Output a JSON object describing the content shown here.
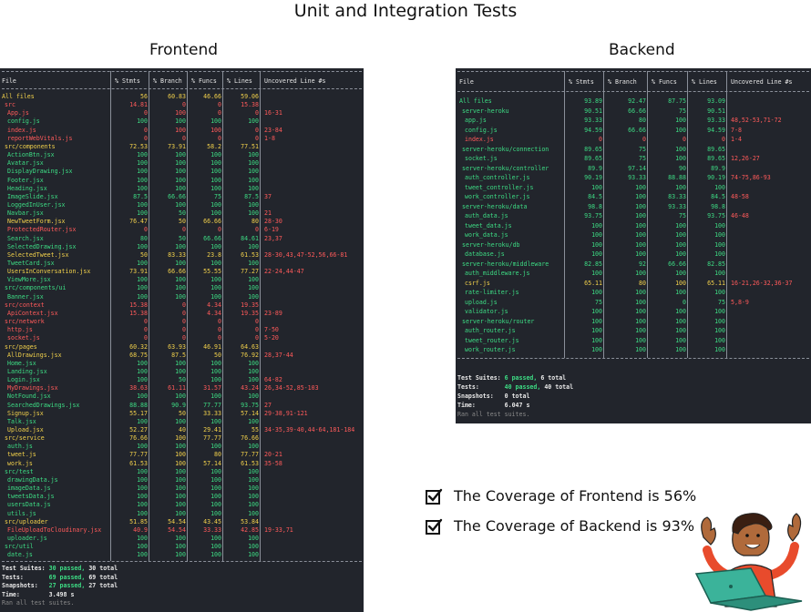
{
  "page": {
    "title": "Unit and Integration Tests",
    "frontend_label": "Frontend",
    "backend_label": "Backend"
  },
  "headers": [
    "File",
    "% Stmts",
    "% Branch",
    "% Funcs",
    "% Lines",
    "Uncovered Line #s"
  ],
  "frontend": {
    "rows": [
      {
        "file": "All files",
        "indent": 0,
        "stmts": "56",
        "branch": "60.83",
        "funcs": "46.66",
        "lines": "59.06",
        "uncovered": "",
        "color": "y"
      },
      {
        "file": "src",
        "indent": 1,
        "stmts": "14.81",
        "branch": "0",
        "funcs": "0",
        "lines": "15.38",
        "uncovered": "",
        "color": "r"
      },
      {
        "file": "App.js",
        "indent": 2,
        "stmts": "0",
        "branch": "100",
        "funcs": "0",
        "lines": "0",
        "uncovered": "16-31",
        "color": "r"
      },
      {
        "file": "config.js",
        "indent": 2,
        "stmts": "100",
        "branch": "100",
        "funcs": "100",
        "lines": "100",
        "uncovered": "",
        "color": "g"
      },
      {
        "file": "index.js",
        "indent": 2,
        "stmts": "0",
        "branch": "100",
        "funcs": "100",
        "lines": "0",
        "uncovered": "23-84",
        "color": "r"
      },
      {
        "file": "reportWebVitals.js",
        "indent": 2,
        "stmts": "0",
        "branch": "0",
        "funcs": "0",
        "lines": "0",
        "uncovered": "1-8",
        "color": "r"
      },
      {
        "file": "src/components",
        "indent": 1,
        "stmts": "72.53",
        "branch": "73.91",
        "funcs": "58.2",
        "lines": "77.51",
        "uncovered": "",
        "color": "y"
      },
      {
        "file": "ActionBtn.jsx",
        "indent": 2,
        "stmts": "100",
        "branch": "100",
        "funcs": "100",
        "lines": "100",
        "uncovered": "",
        "color": "g"
      },
      {
        "file": "Avatar.jsx",
        "indent": 2,
        "stmts": "100",
        "branch": "100",
        "funcs": "100",
        "lines": "100",
        "uncovered": "",
        "color": "g"
      },
      {
        "file": "DisplayDrawing.jsx",
        "indent": 2,
        "stmts": "100",
        "branch": "100",
        "funcs": "100",
        "lines": "100",
        "uncovered": "",
        "color": "g"
      },
      {
        "file": "Footer.jsx",
        "indent": 2,
        "stmts": "100",
        "branch": "100",
        "funcs": "100",
        "lines": "100",
        "uncovered": "",
        "color": "g"
      },
      {
        "file": "Heading.jsx",
        "indent": 2,
        "stmts": "100",
        "branch": "100",
        "funcs": "100",
        "lines": "100",
        "uncovered": "",
        "color": "g"
      },
      {
        "file": "ImageSlide.jsx",
        "indent": 2,
        "stmts": "87.5",
        "branch": "66.66",
        "funcs": "75",
        "lines": "87.5",
        "uncovered": "37",
        "color": "g"
      },
      {
        "file": "LoggedInUser.jsx",
        "indent": 2,
        "stmts": "100",
        "branch": "100",
        "funcs": "100",
        "lines": "100",
        "uncovered": "",
        "color": "g"
      },
      {
        "file": "Navbar.jsx",
        "indent": 2,
        "stmts": "100",
        "branch": "50",
        "funcs": "100",
        "lines": "100",
        "uncovered": "21",
        "color": "g"
      },
      {
        "file": "NewTweetForm.jsx",
        "indent": 2,
        "stmts": "76.47",
        "branch": "50",
        "funcs": "66.66",
        "lines": "80",
        "uncovered": "28-30",
        "color": "y"
      },
      {
        "file": "ProtectedRouter.jsx",
        "indent": 2,
        "stmts": "0",
        "branch": "0",
        "funcs": "0",
        "lines": "0",
        "uncovered": "6-19",
        "color": "r"
      },
      {
        "file": "Search.jsx",
        "indent": 2,
        "stmts": "80",
        "branch": "50",
        "funcs": "66.66",
        "lines": "84.61",
        "uncovered": "23,37",
        "color": "g"
      },
      {
        "file": "SelectedDrawing.jsx",
        "indent": 2,
        "stmts": "100",
        "branch": "100",
        "funcs": "100",
        "lines": "100",
        "uncovered": "",
        "color": "g"
      },
      {
        "file": "SelectedTweet.jsx",
        "indent": 2,
        "stmts": "50",
        "branch": "83.33",
        "funcs": "23.8",
        "lines": "61.53",
        "uncovered": "28-30,43,47-52,56,66-81",
        "color": "y"
      },
      {
        "file": "TweetCard.jsx",
        "indent": 2,
        "stmts": "100",
        "branch": "100",
        "funcs": "100",
        "lines": "100",
        "uncovered": "",
        "color": "g"
      },
      {
        "file": "UsersInConversation.jsx",
        "indent": 2,
        "stmts": "73.91",
        "branch": "66.66",
        "funcs": "55.55",
        "lines": "77.27",
        "uncovered": "22-24,44-47",
        "color": "y"
      },
      {
        "file": "ViewMore.jsx",
        "indent": 2,
        "stmts": "100",
        "branch": "100",
        "funcs": "100",
        "lines": "100",
        "uncovered": "",
        "color": "g"
      },
      {
        "file": "src/components/ui",
        "indent": 1,
        "stmts": "100",
        "branch": "100",
        "funcs": "100",
        "lines": "100",
        "uncovered": "",
        "color": "g"
      },
      {
        "file": "Banner.jsx",
        "indent": 2,
        "stmts": "100",
        "branch": "100",
        "funcs": "100",
        "lines": "100",
        "uncovered": "",
        "color": "g"
      },
      {
        "file": "src/context",
        "indent": 1,
        "stmts": "15.38",
        "branch": "0",
        "funcs": "4.34",
        "lines": "19.35",
        "uncovered": "",
        "color": "r"
      },
      {
        "file": "ApiContext.jsx",
        "indent": 2,
        "stmts": "15.38",
        "branch": "0",
        "funcs": "4.34",
        "lines": "19.35",
        "uncovered": "23-89",
        "color": "r"
      },
      {
        "file": "src/network",
        "indent": 1,
        "stmts": "0",
        "branch": "0",
        "funcs": "0",
        "lines": "0",
        "uncovered": "",
        "color": "r"
      },
      {
        "file": "http.js",
        "indent": 2,
        "stmts": "0",
        "branch": "0",
        "funcs": "0",
        "lines": "0",
        "uncovered": "7-50",
        "color": "r"
      },
      {
        "file": "socket.js",
        "indent": 2,
        "stmts": "0",
        "branch": "0",
        "funcs": "0",
        "lines": "0",
        "uncovered": "5-20",
        "color": "r"
      },
      {
        "file": "src/pages",
        "indent": 1,
        "stmts": "60.32",
        "branch": "63.93",
        "funcs": "46.91",
        "lines": "64.63",
        "uncovered": "",
        "color": "y"
      },
      {
        "file": "AllDrawings.jsx",
        "indent": 2,
        "stmts": "68.75",
        "branch": "87.5",
        "funcs": "50",
        "lines": "76.92",
        "uncovered": "28,37-44",
        "color": "y"
      },
      {
        "file": "Home.jsx",
        "indent": 2,
        "stmts": "100",
        "branch": "100",
        "funcs": "100",
        "lines": "100",
        "uncovered": "",
        "color": "g"
      },
      {
        "file": "Landing.jsx",
        "indent": 2,
        "stmts": "100",
        "branch": "100",
        "funcs": "100",
        "lines": "100",
        "uncovered": "",
        "color": "g"
      },
      {
        "file": "Login.jsx",
        "indent": 2,
        "stmts": "100",
        "branch": "50",
        "funcs": "100",
        "lines": "100",
        "uncovered": "64-82",
        "color": "g"
      },
      {
        "file": "MyDrawings.jsx",
        "indent": 2,
        "stmts": "38.63",
        "branch": "61.11",
        "funcs": "31.57",
        "lines": "43.24",
        "uncovered": "26,34-52,85-103",
        "color": "r"
      },
      {
        "file": "NotFound.jsx",
        "indent": 2,
        "stmts": "100",
        "branch": "100",
        "funcs": "100",
        "lines": "100",
        "uncovered": "",
        "color": "g"
      },
      {
        "file": "SearchedDrawings.jsx",
        "indent": 2,
        "stmts": "88.88",
        "branch": "90.9",
        "funcs": "77.77",
        "lines": "93.75",
        "uncovered": "27",
        "color": "g"
      },
      {
        "file": "Signup.jsx",
        "indent": 2,
        "stmts": "55.17",
        "branch": "50",
        "funcs": "33.33",
        "lines": "57.14",
        "uncovered": "29-38,91-121",
        "color": "y"
      },
      {
        "file": "Talk.jsx",
        "indent": 2,
        "stmts": "100",
        "branch": "100",
        "funcs": "100",
        "lines": "100",
        "uncovered": "",
        "color": "g"
      },
      {
        "file": "Upload.jsx",
        "indent": 2,
        "stmts": "52.27",
        "branch": "40",
        "funcs": "29.41",
        "lines": "55",
        "uncovered": "34-35,39-40,44-64,181-184",
        "color": "y"
      },
      {
        "file": "src/service",
        "indent": 1,
        "stmts": "76.66",
        "branch": "100",
        "funcs": "77.77",
        "lines": "76.66",
        "uncovered": "",
        "color": "y"
      },
      {
        "file": "auth.js",
        "indent": 2,
        "stmts": "100",
        "branch": "100",
        "funcs": "100",
        "lines": "100",
        "uncovered": "",
        "color": "g"
      },
      {
        "file": "tweet.js",
        "indent": 2,
        "stmts": "77.77",
        "branch": "100",
        "funcs": "80",
        "lines": "77.77",
        "uncovered": "20-21",
        "color": "y"
      },
      {
        "file": "work.js",
        "indent": 2,
        "stmts": "61.53",
        "branch": "100",
        "funcs": "57.14",
        "lines": "61.53",
        "uncovered": "35-58",
        "color": "y"
      },
      {
        "file": "src/test",
        "indent": 1,
        "stmts": "100",
        "branch": "100",
        "funcs": "100",
        "lines": "100",
        "uncovered": "",
        "color": "g"
      },
      {
        "file": "drawingData.js",
        "indent": 2,
        "stmts": "100",
        "branch": "100",
        "funcs": "100",
        "lines": "100",
        "uncovered": "",
        "color": "g"
      },
      {
        "file": "imageData.js",
        "indent": 2,
        "stmts": "100",
        "branch": "100",
        "funcs": "100",
        "lines": "100",
        "uncovered": "",
        "color": "g"
      },
      {
        "file": "tweetsData.js",
        "indent": 2,
        "stmts": "100",
        "branch": "100",
        "funcs": "100",
        "lines": "100",
        "uncovered": "",
        "color": "g"
      },
      {
        "file": "usersData.js",
        "indent": 2,
        "stmts": "100",
        "branch": "100",
        "funcs": "100",
        "lines": "100",
        "uncovered": "",
        "color": "g"
      },
      {
        "file": "utils.js",
        "indent": 2,
        "stmts": "100",
        "branch": "100",
        "funcs": "100",
        "lines": "100",
        "uncovered": "",
        "color": "g"
      },
      {
        "file": "src/uploader",
        "indent": 1,
        "stmts": "51.85",
        "branch": "54.54",
        "funcs": "43.45",
        "lines": "53.84",
        "uncovered": "",
        "color": "y"
      },
      {
        "file": "FileUploadToCloudinary.jsx",
        "indent": 2,
        "stmts": "40.9",
        "branch": "54.54",
        "funcs": "33.33",
        "lines": "42.85",
        "uncovered": "19-33,71",
        "color": "r"
      },
      {
        "file": "uploader.js",
        "indent": 2,
        "stmts": "100",
        "branch": "100",
        "funcs": "100",
        "lines": "100",
        "uncovered": "",
        "color": "g"
      },
      {
        "file": "src/util",
        "indent": 1,
        "stmts": "100",
        "branch": "100",
        "funcs": "100",
        "lines": "100",
        "uncovered": "",
        "color": "g"
      },
      {
        "file": "date.js",
        "indent": 2,
        "stmts": "100",
        "branch": "100",
        "funcs": "100",
        "lines": "100",
        "uncovered": "",
        "color": "g"
      }
    ],
    "summary": {
      "suites_label": "Test Suites:",
      "suites_passed": "30 passed,",
      "suites_total": "30 total",
      "tests_label": "Tests:",
      "tests_passed": "69 passed,",
      "tests_total": "69 total",
      "snapshots_label": "Snapshots:",
      "snapshots_passed": "27 passed,",
      "snapshots_total": "27 total",
      "time_label": "Time:",
      "time_value": "3.498 s",
      "footer": "Ran all test suites."
    }
  },
  "backend": {
    "rows": [
      {
        "file": "All files",
        "indent": 0,
        "stmts": "93.89",
        "branch": "92.47",
        "funcs": "87.75",
        "lines": "93.09",
        "uncovered": "",
        "color": "g"
      },
      {
        "file": "server-heroku",
        "indent": 1,
        "stmts": "90.51",
        "branch": "66.66",
        "funcs": "75",
        "lines": "90.51",
        "uncovered": "",
        "color": "g"
      },
      {
        "file": "app.js",
        "indent": 2,
        "stmts": "93.33",
        "branch": "80",
        "funcs": "100",
        "lines": "93.33",
        "uncovered": "48,52-53,71-72",
        "color": "g"
      },
      {
        "file": "config.js",
        "indent": 2,
        "stmts": "94.59",
        "branch": "66.66",
        "funcs": "100",
        "lines": "94.59",
        "uncovered": "7-8",
        "color": "g"
      },
      {
        "file": "index.js",
        "indent": 2,
        "stmts": "0",
        "branch": "0",
        "funcs": "0",
        "lines": "0",
        "uncovered": "1-4",
        "color": "r"
      },
      {
        "file": "server-heroku/connection",
        "indent": 1,
        "stmts": "89.65",
        "branch": "75",
        "funcs": "100",
        "lines": "89.65",
        "uncovered": "",
        "color": "g"
      },
      {
        "file": "socket.js",
        "indent": 2,
        "stmts": "89.65",
        "branch": "75",
        "funcs": "100",
        "lines": "89.65",
        "uncovered": "12,26-27",
        "color": "g"
      },
      {
        "file": "server-heroku/controller",
        "indent": 1,
        "stmts": "89.9",
        "branch": "97.14",
        "funcs": "90",
        "lines": "89.9",
        "uncovered": "",
        "color": "g"
      },
      {
        "file": "auth_controller.js",
        "indent": 2,
        "stmts": "90.19",
        "branch": "93.33",
        "funcs": "88.88",
        "lines": "90.19",
        "uncovered": "74-75,86-93",
        "color": "g"
      },
      {
        "file": "tweet_controller.js",
        "indent": 2,
        "stmts": "100",
        "branch": "100",
        "funcs": "100",
        "lines": "100",
        "uncovered": "",
        "color": "g"
      },
      {
        "file": "work_controller.js",
        "indent": 2,
        "stmts": "84.5",
        "branch": "100",
        "funcs": "83.33",
        "lines": "84.5",
        "uncovered": "48-58",
        "color": "g"
      },
      {
        "file": "server-heroku/data",
        "indent": 1,
        "stmts": "98.8",
        "branch": "100",
        "funcs": "93.33",
        "lines": "98.8",
        "uncovered": "",
        "color": "g"
      },
      {
        "file": "auth_data.js",
        "indent": 2,
        "stmts": "93.75",
        "branch": "100",
        "funcs": "75",
        "lines": "93.75",
        "uncovered": "46-48",
        "color": "g"
      },
      {
        "file": "tweet_data.js",
        "indent": 2,
        "stmts": "100",
        "branch": "100",
        "funcs": "100",
        "lines": "100",
        "uncovered": "",
        "color": "g"
      },
      {
        "file": "work_data.js",
        "indent": 2,
        "stmts": "100",
        "branch": "100",
        "funcs": "100",
        "lines": "100",
        "uncovered": "",
        "color": "g"
      },
      {
        "file": "server-heroku/db",
        "indent": 1,
        "stmts": "100",
        "branch": "100",
        "funcs": "100",
        "lines": "100",
        "uncovered": "",
        "color": "g"
      },
      {
        "file": "database.js",
        "indent": 2,
        "stmts": "100",
        "branch": "100",
        "funcs": "100",
        "lines": "100",
        "uncovered": "",
        "color": "g"
      },
      {
        "file": "server-heroku/middleware",
        "indent": 1,
        "stmts": "82.85",
        "branch": "92",
        "funcs": "66.66",
        "lines": "82.85",
        "uncovered": "",
        "color": "g"
      },
      {
        "file": "auth_middleware.js",
        "indent": 2,
        "stmts": "100",
        "branch": "100",
        "funcs": "100",
        "lines": "100",
        "uncovered": "",
        "color": "g"
      },
      {
        "file": "csrf.js",
        "indent": 2,
        "stmts": "65.11",
        "branch": "80",
        "funcs": "100",
        "lines": "65.11",
        "uncovered": "16-21,26-32,36-37",
        "color": "y"
      },
      {
        "file": "rate-limiter.js",
        "indent": 2,
        "stmts": "100",
        "branch": "100",
        "funcs": "100",
        "lines": "100",
        "uncovered": "",
        "color": "g"
      },
      {
        "file": "upload.js",
        "indent": 2,
        "stmts": "75",
        "branch": "100",
        "funcs": "0",
        "lines": "75",
        "uncovered": "5,8-9",
        "color": "g"
      },
      {
        "file": "validator.js",
        "indent": 2,
        "stmts": "100",
        "branch": "100",
        "funcs": "100",
        "lines": "100",
        "uncovered": "",
        "color": "g"
      },
      {
        "file": "server-heroku/router",
        "indent": 1,
        "stmts": "100",
        "branch": "100",
        "funcs": "100",
        "lines": "100",
        "uncovered": "",
        "color": "g"
      },
      {
        "file": "auth_router.js",
        "indent": 2,
        "stmts": "100",
        "branch": "100",
        "funcs": "100",
        "lines": "100",
        "uncovered": "",
        "color": "g"
      },
      {
        "file": "tweet_router.js",
        "indent": 2,
        "stmts": "100",
        "branch": "100",
        "funcs": "100",
        "lines": "100",
        "uncovered": "",
        "color": "g"
      },
      {
        "file": "work_router.js",
        "indent": 2,
        "stmts": "100",
        "branch": "100",
        "funcs": "100",
        "lines": "100",
        "uncovered": "",
        "color": "g"
      }
    ],
    "summary": {
      "suites_label": "Test Suites:",
      "suites_passed": "6 passed,",
      "suites_total": "6 total",
      "tests_label": "Tests:",
      "tests_passed": "40 passed,",
      "tests_total": "40 total",
      "snapshots_label": "Snapshots:",
      "snapshots_value": "0 total",
      "time_label": "Time:",
      "time_value": "6.047 s",
      "footer": "Ran all test suites."
    }
  },
  "checklist": [
    {
      "text": "The Coverage of Frontend is 56%"
    },
    {
      "text": "The Coverage of Backend is 93%"
    }
  ],
  "colors": {
    "green": "#3ddc84",
    "yellow": "#f2d14b",
    "red": "#ff5a5a",
    "terminal_bg": "#22252c"
  },
  "icons": {
    "check": "checkbox-checked-icon",
    "character": "person-with-laptop-illustration"
  }
}
